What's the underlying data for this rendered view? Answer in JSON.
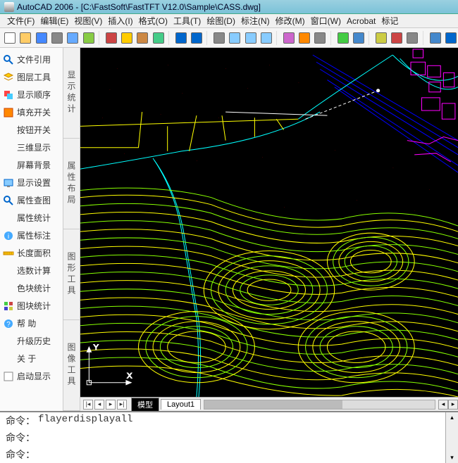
{
  "title": "AutoCAD 2006 - [C:\\FastSoft\\FastTFT V12.0\\Sample\\CASS.dwg]",
  "menu": [
    "文件(F)",
    "编辑(E)",
    "视图(V)",
    "插入(I)",
    "格式(O)",
    "工具(T)",
    "绘图(D)",
    "标注(N)",
    "修改(M)",
    "窗口(W)",
    "Acrobat",
    "标记"
  ],
  "left_items": [
    {
      "icon": "ref-icon",
      "label": "文件引用"
    },
    {
      "icon": "layers-icon",
      "label": "图层工具"
    },
    {
      "icon": "order-icon",
      "label": "显示顺序"
    },
    {
      "icon": "fill-icon",
      "label": "填充开关"
    },
    {
      "icon": "blank",
      "label": "按钮开关"
    },
    {
      "icon": "blank",
      "label": "三维显示"
    },
    {
      "icon": "blank",
      "label": "屏幕背景"
    },
    {
      "icon": "dispset-icon",
      "label": "显示设置"
    },
    {
      "icon": "zoom-icon",
      "label": "属性查图"
    },
    {
      "icon": "blank",
      "label": "属性统计"
    },
    {
      "icon": "info-icon",
      "label": "属性标注"
    },
    {
      "icon": "measure-icon",
      "label": "长度面积"
    },
    {
      "icon": "blank",
      "label": "选数计算"
    },
    {
      "icon": "blank",
      "label": "色块统计"
    },
    {
      "icon": "blocks-icon",
      "label": "图块统计"
    },
    {
      "icon": "help-icon",
      "label": "帮    助"
    },
    {
      "icon": "blank",
      "label": "升级历史"
    },
    {
      "icon": "blank",
      "label": "关    于"
    },
    {
      "icon": "checkbox",
      "label": "启动显示"
    }
  ],
  "vtabs": [
    "显示统计",
    "属性布局",
    "图形工具",
    "图像工具"
  ],
  "ucs": {
    "x": "X",
    "y": "Y"
  },
  "model_tab": "模型",
  "layout_tab": "Layout1",
  "cmd_prompt": "命令：",
  "cmd_lines": [
    "flayerdisplayall",
    "",
    ""
  ],
  "toolbar_icons": [
    "new",
    "open",
    "save",
    "print",
    "preview",
    "publish",
    "sep",
    "cut",
    "copy",
    "paste",
    "match",
    "sep",
    "undo",
    "redo",
    "sep",
    "pan",
    "zoom",
    "zoomwin",
    "zoomprev",
    "sep",
    "props",
    "dc",
    "tool",
    "sep",
    "block",
    "table",
    "sep",
    "sheet",
    "markup",
    "calc",
    "sep",
    "ws",
    "help"
  ]
}
